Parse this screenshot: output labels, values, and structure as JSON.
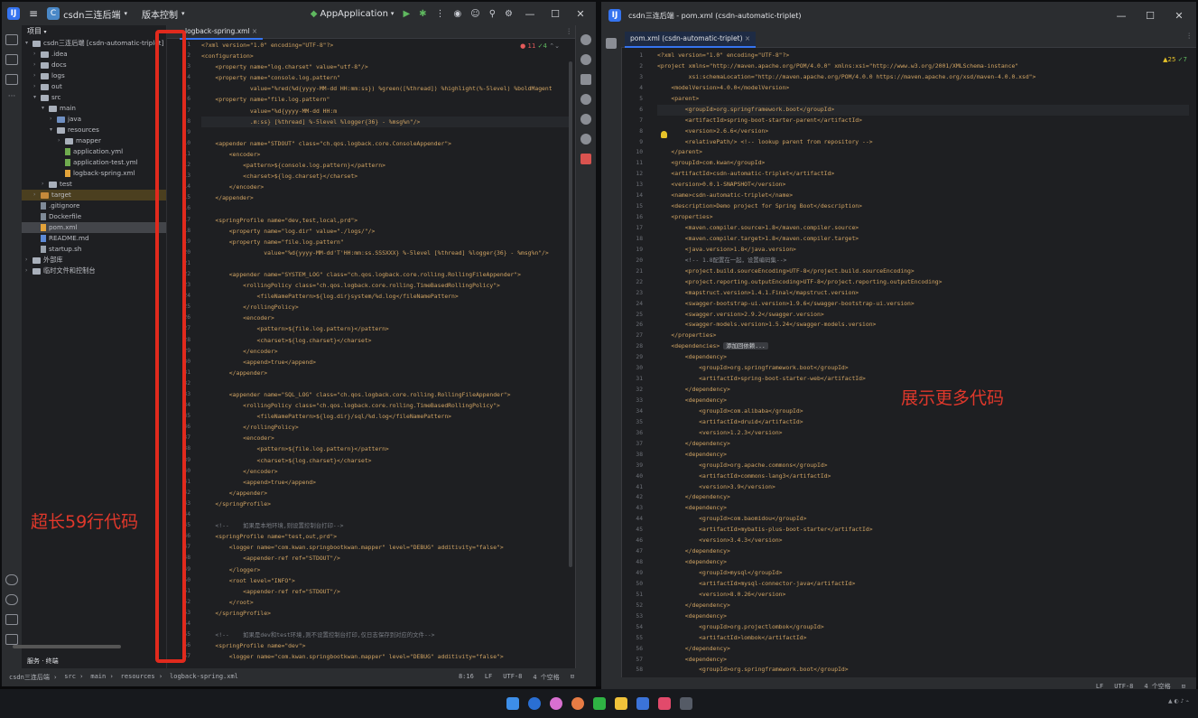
{
  "left": {
    "project_name": "csdn三连后端",
    "vcs_label": "版本控制",
    "run_config": "AppApplication",
    "tab": "logback-spring.xml",
    "inspections": {
      "errors": "11",
      "ok": "4"
    },
    "panel_title": "项目",
    "tree": [
      {
        "label": "csdn三连后端 [csdn-automatic-triplet]",
        "indent": 0,
        "icon": "folder",
        "arrow": "▾"
      },
      {
        "label": ".idea",
        "indent": 1,
        "icon": "folder",
        "arrow": "›"
      },
      {
        "label": "docs",
        "indent": 1,
        "icon": "folder",
        "arrow": "›"
      },
      {
        "label": "logs",
        "indent": 1,
        "icon": "folder",
        "arrow": "›"
      },
      {
        "label": "out",
        "indent": 1,
        "icon": "folder",
        "arrow": "›"
      },
      {
        "label": "src",
        "indent": 1,
        "icon": "folder",
        "arrow": "▾"
      },
      {
        "label": "main",
        "indent": 2,
        "icon": "folder",
        "arrow": "▾"
      },
      {
        "label": "java",
        "indent": 3,
        "icon": "folder blue",
        "arrow": "›"
      },
      {
        "label": "resources",
        "indent": 3,
        "icon": "folder",
        "arrow": "▾"
      },
      {
        "label": "mapper",
        "indent": 4,
        "icon": "folder",
        "arrow": "›"
      },
      {
        "label": "application.yml",
        "indent": 4,
        "icon": "file yml",
        "arrow": ""
      },
      {
        "label": "application-test.yml",
        "indent": 4,
        "icon": "file yml",
        "arrow": ""
      },
      {
        "label": "logback-spring.xml",
        "indent": 4,
        "icon": "file xml",
        "arrow": ""
      },
      {
        "label": "test",
        "indent": 2,
        "icon": "folder",
        "arrow": "›"
      },
      {
        "label": "target",
        "indent": 1,
        "icon": "folder orange",
        "arrow": "›",
        "target": true
      },
      {
        "label": ".gitignore",
        "indent": 1,
        "icon": "file",
        "arrow": ""
      },
      {
        "label": "Dockerfile",
        "indent": 1,
        "icon": "file",
        "arrow": ""
      },
      {
        "label": "pom.xml",
        "indent": 1,
        "icon": "file xml",
        "arrow": "",
        "selected": true
      },
      {
        "label": "README.md",
        "indent": 1,
        "icon": "file md",
        "arrow": ""
      },
      {
        "label": "startup.sh",
        "indent": 1,
        "icon": "file sh",
        "arrow": ""
      },
      {
        "label": "外部库",
        "indent": 0,
        "icon": "folder",
        "arrow": "›"
      },
      {
        "label": "临时文件和控制台",
        "indent": 0,
        "icon": "folder",
        "arrow": "›"
      }
    ],
    "code": [
      "<?xml version=\"1.0\" encoding=\"UTF-8\"?>",
      "<configuration>",
      "    <property name=\"log.charset\" value=\"utf-8\"/>",
      "    <property name=\"console.log.pattern\"",
      "              value=\"%red(%d{yyyy-MM-dd HH:mm:ss}) %green([%thread]) %highlight(%-5level) %boldMagent",
      "    <property name=\"file.log.pattern\"",
      "              value=\"%d{yyyy-MM-dd HH:m",
      "              .m:ss} [%thread] %-5level %logger{36} - %msg%n\"/>",
      "",
      "    <appender name=\"STDOUT\" class=\"ch.qos.logback.core.ConsoleAppender\">",
      "        <encoder>",
      "            <pattern>${console.log.pattern}</pattern>",
      "            <charset>${log.charset}</charset>",
      "        </encoder>",
      "    </appender>",
      "",
      "    <springProfile name=\"dev,test,local,prd\">",
      "        <property name=\"log.dir\" value=\"./logs/\"/>",
      "        <property name=\"file.log.pattern\"",
      "                  value=\"%d{yyyy-MM-dd'T'HH:mm:ss.SSSXXX} %-5level [%thread] %logger{36} - %msg%n\"/>",
      "",
      "        <appender name=\"SYSTEM_LOG\" class=\"ch.qos.logback.core.rolling.RollingFileAppender\">",
      "            <rollingPolicy class=\"ch.qos.logback.core.rolling.TimeBasedRollingPolicy\">",
      "                <fileNamePattern>${log.dir}system/%d.log</fileNamePattern>",
      "            </rollingPolicy>",
      "            <encoder>",
      "                <pattern>${file.log.pattern}</pattern>",
      "                <charset>${log.charset}</charset>",
      "            </encoder>",
      "            <append>true</append>",
      "        </appender>",
      "",
      "        <appender name=\"SQL_LOG\" class=\"ch.qos.logback.core.rolling.RollingFileAppender\">",
      "            <rollingPolicy class=\"ch.qos.logback.core.rolling.TimeBasedRollingPolicy\">",
      "                <fileNamePattern>${log.dir}/sql/%d.log</fileNamePattern>",
      "            </rollingPolicy>",
      "            <encoder>",
      "                <pattern>${file.log.pattern}</pattern>",
      "                <charset>${log.charset}</charset>",
      "            </encoder>",
      "            <append>true</append>",
      "        </appender>",
      "    </springProfile>",
      "",
      "    <!--    如果是本地环境,则设置控制台打印-->",
      "    <springProfile name=\"test,out,prd\">",
      "        <logger name=\"com.kwan.springbootkwan.mapper\" level=\"DEBUG\" additivity=\"false\">",
      "            <appender-ref ref=\"STDOUT\"/>",
      "        </logger>",
      "        <root level=\"INFO\">",
      "            <appender-ref ref=\"STDOUT\"/>",
      "        </root>",
      "    </springProfile>",
      "",
      "    <!--    如果是dev和test环境,则不设置控制台打印,仅日志保存到对应的文件-->",
      "    <springProfile name=\"dev\">",
      "        <logger name=\"com.kwan.springbootkwan.mapper\" level=\"DEBUG\" additivity=\"false\">"
    ],
    "status": {
      "path": [
        "csdn三连后端",
        "src",
        "main",
        "resources",
        "logback-spring.xml"
      ],
      "position": "8:16",
      "line_sep": "LF",
      "encoding": "UTF-8",
      "indent": "4 个空格"
    },
    "annotation": "超长59行代码"
  },
  "right": {
    "title": "csdn三连后端 - pom.xml (csdn-automatic-triplet)",
    "tab": "pom.xml (csdn-automatic-triplet)",
    "inspections": {
      "warnings": "25",
      "ok": "7"
    },
    "inlay_hint": "添加回依赖...",
    "code": [
      "<?xml version=\"1.0\" encoding=\"UTF-8\"?>",
      "<project xmlns=\"http://maven.apache.org/POM/4.0.0\" xmlns:xsi=\"http://www.w3.org/2001/XMLSchema-instance\"",
      "         xsi:schemaLocation=\"http://maven.apache.org/POM/4.0.0 https://maven.apache.org/xsd/maven-4.0.0.xsd\">",
      "    <modelVersion>4.0.0</modelVersion>",
      "    <parent>",
      "        <groupId>org.springframework.boot</groupId>",
      "        <artifactId>spring-boot-starter-parent</artifactId>",
      "        <version>2.6.6</version>",
      "        <relativePath/> <!-- lookup parent from repository -->",
      "    </parent>",
      "    <groupId>com.kwan</groupId>",
      "    <artifactId>csdn-automatic-triplet</artifactId>",
      "    <version>0.0.1-SNAPSHOT</version>",
      "    <name>csdn-automatic-triplet</name>",
      "    <description>Demo project for Spring Boot</description>",
      "    <properties>",
      "        <maven.compiler.source>1.8</maven.compiler.source>",
      "        <maven.compiler.target>1.8</maven.compiler.target>",
      "        <java.version>1.8</java.version>",
      "        <!-- 1.8配置在一起，设置编码集-->",
      "        <project.build.sourceEncoding>UTF-8</project.build.sourceEncoding>",
      "        <project.reporting.outputEncoding>UTF-8</project.reporting.outputEncoding>",
      "        <mapstruct.version>1.4.1.Final</mapstruct.version>",
      "        <swagger-bootstrap-ui.version>1.9.6</swagger-bootstrap-ui.version>",
      "        <swagger.version>2.9.2</swagger.version>",
      "        <swagger-models.version>1.5.24</swagger-models.version>",
      "    </properties>",
      "    <dependencies>",
      "        <dependency>",
      "            <groupId>org.springframework.boot</groupId>",
      "            <artifactId>spring-boot-starter-web</artifactId>",
      "        </dependency>",
      "        <dependency>",
      "            <groupId>com.alibaba</groupId>",
      "            <artifactId>druid</artifactId>",
      "            <version>1.2.3</version>",
      "        </dependency>",
      "        <dependency>",
      "            <groupId>org.apache.commons</groupId>",
      "            <artifactId>commons-lang3</artifactId>",
      "            <version>3.9</version>",
      "        </dependency>",
      "        <dependency>",
      "            <groupId>com.baomidou</groupId>",
      "            <artifactId>mybatis-plus-boot-starter</artifactId>",
      "            <version>3.4.3</version>",
      "        </dependency>",
      "        <dependency>",
      "            <groupId>mysql</groupId>",
      "            <artifactId>mysql-connector-java</artifactId>",
      "            <version>8.0.26</version>",
      "        </dependency>",
      "        <dependency>",
      "            <groupId>org.projectlombok</groupId>",
      "            <artifactId>lombok</artifactId>",
      "        </dependency>",
      "        <dependency>",
      "            <groupId>org.springframework.boot</groupId>"
    ],
    "status": {
      "line_sep": "LF",
      "encoding": "UTF-8",
      "indent": "4 个空格"
    },
    "annotation": "展示更多代码"
  },
  "icons": [
    "project-icon",
    "commit-icon",
    "structure-icon",
    "more-icon",
    "run-icon",
    "debug-icon",
    "search-icon",
    "settings-icon",
    "database-icon",
    "maven-icon",
    "notifications-icon"
  ]
}
